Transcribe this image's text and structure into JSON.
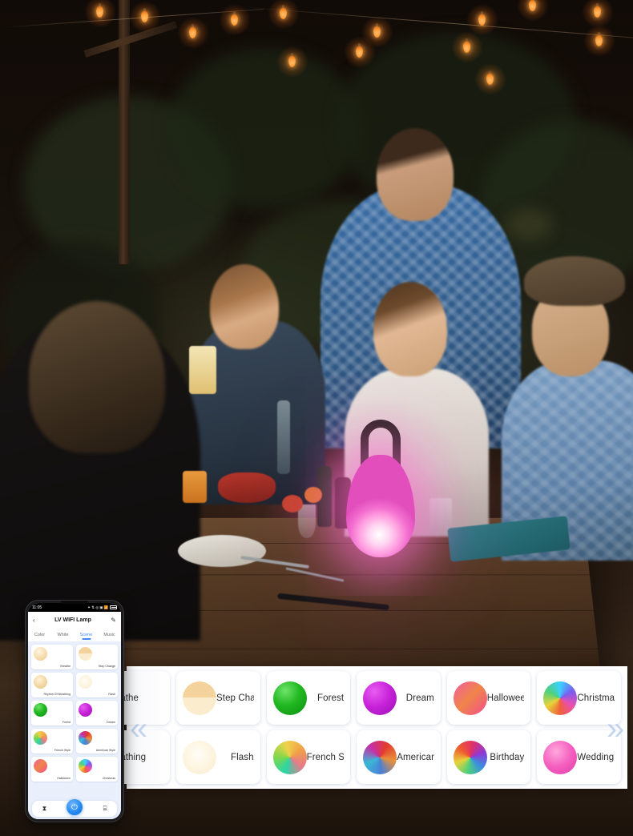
{
  "photo": {
    "description": "Outdoor evening garden party with friends at a wooden table under string lights",
    "lamp": {
      "name": "portable-rgb-lantern",
      "glow_color": "#ff6ed2",
      "handle_color": "#2a2522"
    },
    "string_light_color": "#ffa33c"
  },
  "scene_panel": {
    "nav": {
      "prev": "«",
      "next": "»"
    },
    "rows": [
      [
        {
          "label": "Breathe",
          "swatch": "warm-white-breathe",
          "clipped": true
        },
        {
          "label": "Step Change",
          "swatch": "warm-white-step"
        },
        {
          "label": "Forest",
          "swatch": "green"
        },
        {
          "label": "Dream",
          "swatch": "magenta"
        },
        {
          "label": "Halloween",
          "swatch": "orange-pink"
        },
        {
          "label": "Christmas",
          "swatch": "multicolor-wheel"
        }
      ],
      [
        {
          "label": "Breathing",
          "swatch": "warm-white-rhythm",
          "clipped": true
        },
        {
          "label": "Flash",
          "swatch": "pale-cream"
        },
        {
          "label": "French Style",
          "swatch": "teal-yellow"
        },
        {
          "label": "American Style",
          "swatch": "red-blue-magenta"
        },
        {
          "label": "Birthday",
          "swatch": "rainbow"
        },
        {
          "label": "Wedding Anniversary",
          "swatch": "pink"
        }
      ]
    ]
  },
  "phone": {
    "status_bar": {
      "time": "11:05",
      "icons": "✦ ⇅ ◎ ▣ 📶",
      "battery_text": "85%"
    },
    "app_bar": {
      "back": "‹",
      "title": "LV WIFI Lamp",
      "edit": "✎"
    },
    "tabs": [
      {
        "label": "Color",
        "active": false
      },
      {
        "label": "White",
        "active": false
      },
      {
        "label": "Scene",
        "active": true
      },
      {
        "label": "Music",
        "active": false
      }
    ],
    "scenes": [
      {
        "label": "Breathe",
        "swatch": "warm-white-breathe"
      },
      {
        "label": "Step Change",
        "swatch": "warm-white-step"
      },
      {
        "label": "Rhythm Of Breathing",
        "swatch": "warm-white-rhythm"
      },
      {
        "label": "Flash",
        "swatch": "pale-cream"
      },
      {
        "label": "Forest",
        "swatch": "green"
      },
      {
        "label": "Dream",
        "swatch": "magenta"
      },
      {
        "label": "French Style",
        "swatch": "teal-yellow"
      },
      {
        "label": "American Style",
        "swatch": "red-blue-magenta"
      },
      {
        "label": "Halloween",
        "swatch": "orange-pink"
      },
      {
        "label": "Christmas",
        "swatch": "multicolor-wheel"
      }
    ],
    "bottom_bar": {
      "timer_icon": "⧗",
      "power_icon": "⏻",
      "grid_icon": "⌸"
    }
  }
}
